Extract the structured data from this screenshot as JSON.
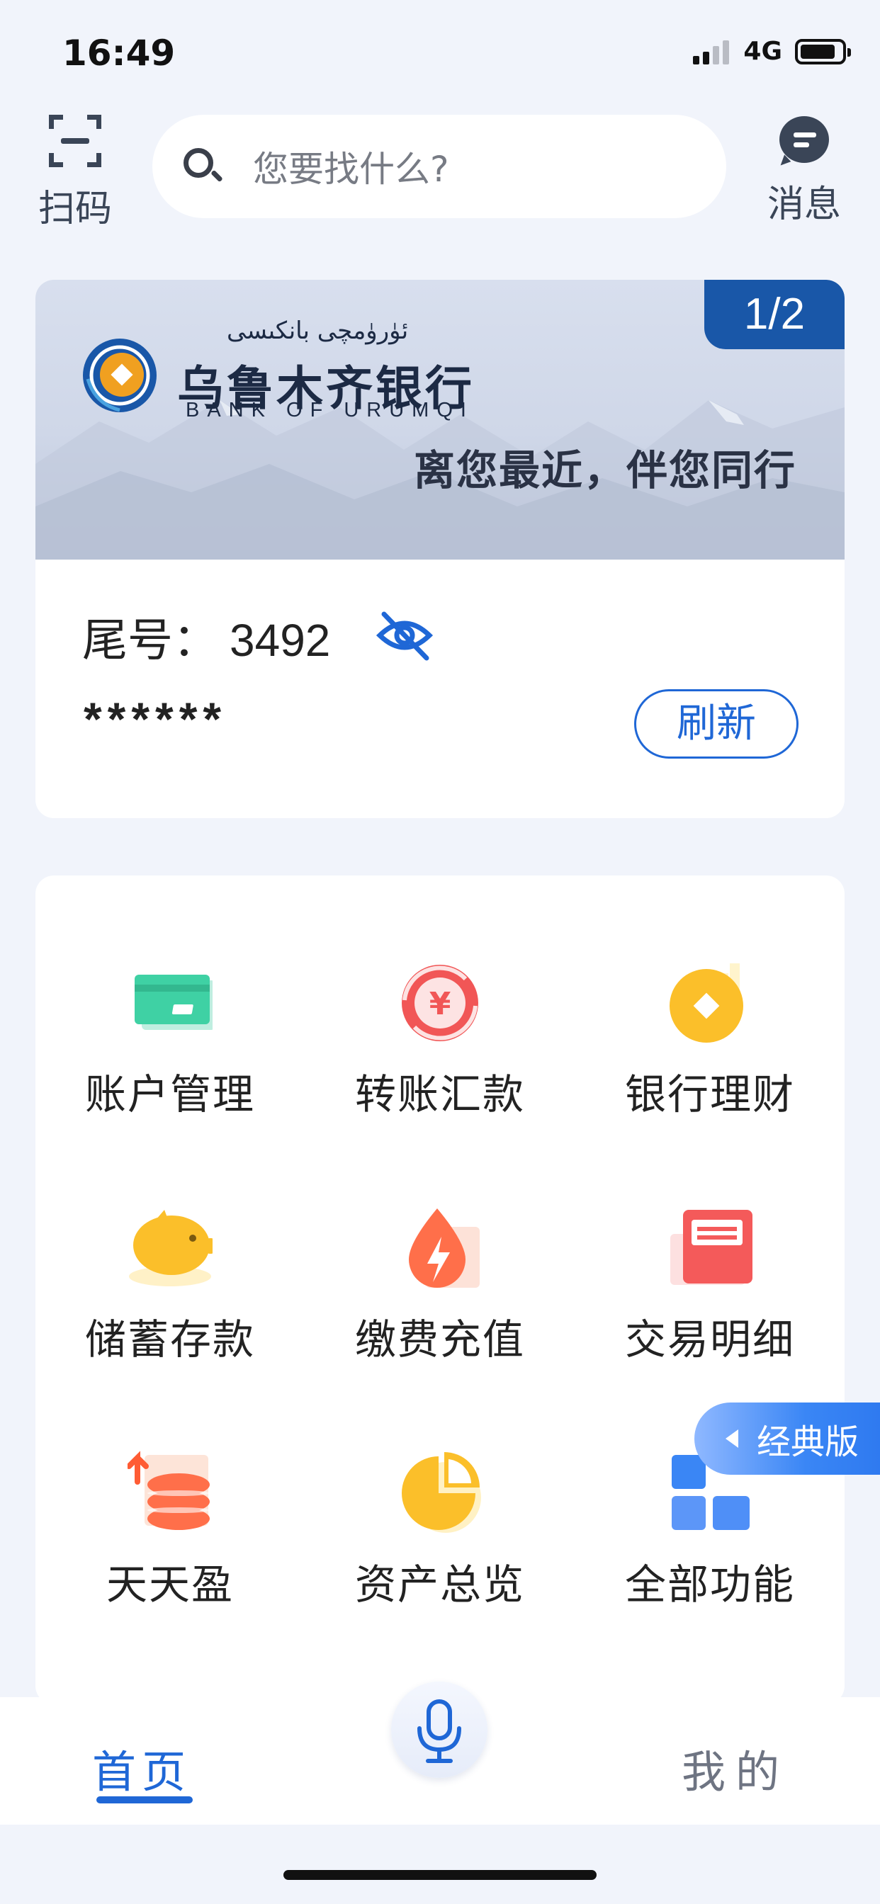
{
  "status_bar": {
    "time": "16:49",
    "network": "4G"
  },
  "header": {
    "scan_label": "扫码",
    "search_placeholder": "您要找什么?",
    "message_label": "消息"
  },
  "card": {
    "page_indicator": "1/2",
    "bank_name_uyghur": "ئۈرۈمچى بانكىسى",
    "bank_name": "乌鲁木齐银行",
    "bank_name_en": "BANK OF URUMQI",
    "slogan": "离您最近，伴您同行",
    "account_label": "尾号：",
    "account_tail": "3492",
    "masked_balance": "******",
    "refresh_label": "刷新"
  },
  "functions": [
    {
      "label": "账户管理",
      "icon": "card-icon"
    },
    {
      "label": "转账汇款",
      "icon": "yuan-transfer-icon"
    },
    {
      "label": "银行理财",
      "icon": "coin-wealth-icon"
    },
    {
      "label": "储蓄存款",
      "icon": "piggy-bank-icon"
    },
    {
      "label": "缴费充值",
      "icon": "lightning-drop-icon"
    },
    {
      "label": "交易明细",
      "icon": "receipt-icon"
    },
    {
      "label": "天天盈",
      "icon": "coin-stack-icon"
    },
    {
      "label": "资产总览",
      "icon": "pie-chart-icon"
    },
    {
      "label": "全部功能",
      "icon": "grid-apps-icon"
    }
  ],
  "classic_toggle": {
    "label": "经典版"
  },
  "bottom_nav": {
    "home_label": "首页",
    "mine_label": "我的",
    "voice_icon": "microphone-icon"
  },
  "colors": {
    "accent": "#1f67d6",
    "badge": "#1957a8",
    "background": "#f1f4fb"
  }
}
